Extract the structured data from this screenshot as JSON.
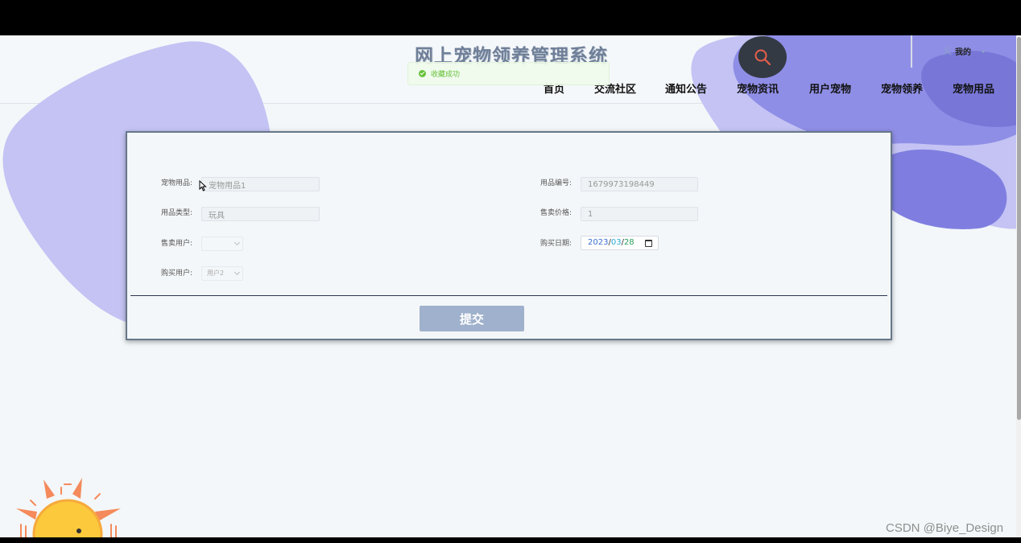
{
  "site": {
    "title": "网上宠物领养管理系统"
  },
  "toast": {
    "message": "收藏成功"
  },
  "user_menu": {
    "label": "我的"
  },
  "nav": {
    "items": [
      "首页",
      "交流社区",
      "通知公告",
      "宠物资讯",
      "用户宠物",
      "宠物领养",
      "宠物用品"
    ]
  },
  "form": {
    "fields": {
      "product": {
        "label": "宠物用品:",
        "value": "宠物用品1"
      },
      "code": {
        "label": "用品编号:",
        "value": "1679973198449"
      },
      "type": {
        "label": "用品类型:",
        "value": "玩具"
      },
      "price": {
        "label": "售卖价格:",
        "value": "1"
      },
      "seller": {
        "label": "售卖用户:",
        "value": ""
      },
      "date": {
        "label": "购买日期:",
        "year": "2023",
        "month": "03",
        "day": "28"
      },
      "buyer": {
        "label": "购买用户:",
        "value": "用户2"
      }
    },
    "submit_label": "提交"
  },
  "watermark": "CSDN @Biye_Design",
  "colors": {
    "accent": "#7f7ee0",
    "blob_light": "#c4c3f4",
    "submit": "#9fb1cc",
    "toast_green": "#67c23a"
  }
}
